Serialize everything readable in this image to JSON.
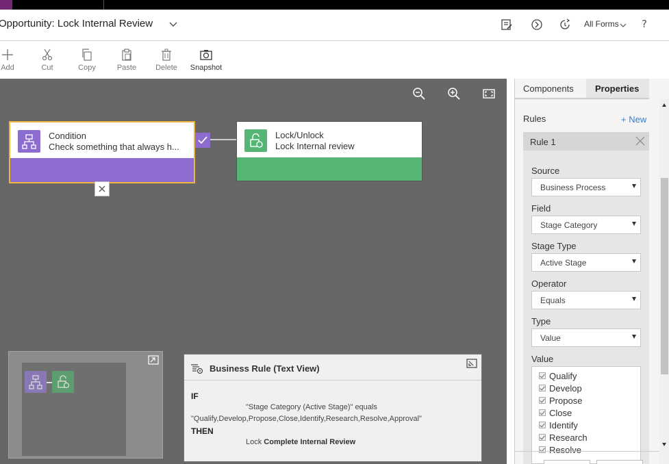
{
  "header": {
    "title": "Opportunity: Lock Internal Review",
    "all_forms": "All Forms",
    "help": "?"
  },
  "toolbar": {
    "add": "Add",
    "cut": "Cut",
    "copy": "Copy",
    "paste": "Paste",
    "delete": "Delete",
    "snapshot": "Snapshot"
  },
  "canvas": {
    "condition": {
      "title": "Condition",
      "subtitle": "Check something that always h..."
    },
    "action": {
      "title": "Lock/Unlock",
      "subtitle": "Lock Internal review"
    }
  },
  "business_rule": {
    "title": "Business Rule (Text View)",
    "if_kw": "IF",
    "condition_line1": "\"Stage Category (Active Stage)\" equals",
    "condition_line2": "\"Qualify,Develop,Propose,Close,Identify,Research,Resolve,Approval\"",
    "then_kw": "THEN",
    "action_prefix": "Lock ",
    "action_target": "Complete Internal Review"
  },
  "panel": {
    "tabs": {
      "components": "Components",
      "properties": "Properties"
    },
    "rules_label": "Rules",
    "new_link": "+ New",
    "rule_name": "Rule 1",
    "fields": {
      "source_label": "Source",
      "source_value": "Business Process",
      "field_label": "Field",
      "field_value": "Stage Category",
      "stage_type_label": "Stage Type",
      "stage_type_value": "Active Stage",
      "operator_label": "Operator",
      "operator_value": "Equals",
      "type_label": "Type",
      "type_value": "Value",
      "value_label": "Value"
    },
    "values": [
      "Qualify",
      "Develop",
      "Propose",
      "Close",
      "Identify",
      "Research",
      "Resolve"
    ]
  },
  "colors": {
    "condition": "#8c6ccf",
    "action": "#54b575",
    "selection_border": "#f0b63d",
    "link": "#3a7ec8",
    "canvas": "#676767"
  }
}
